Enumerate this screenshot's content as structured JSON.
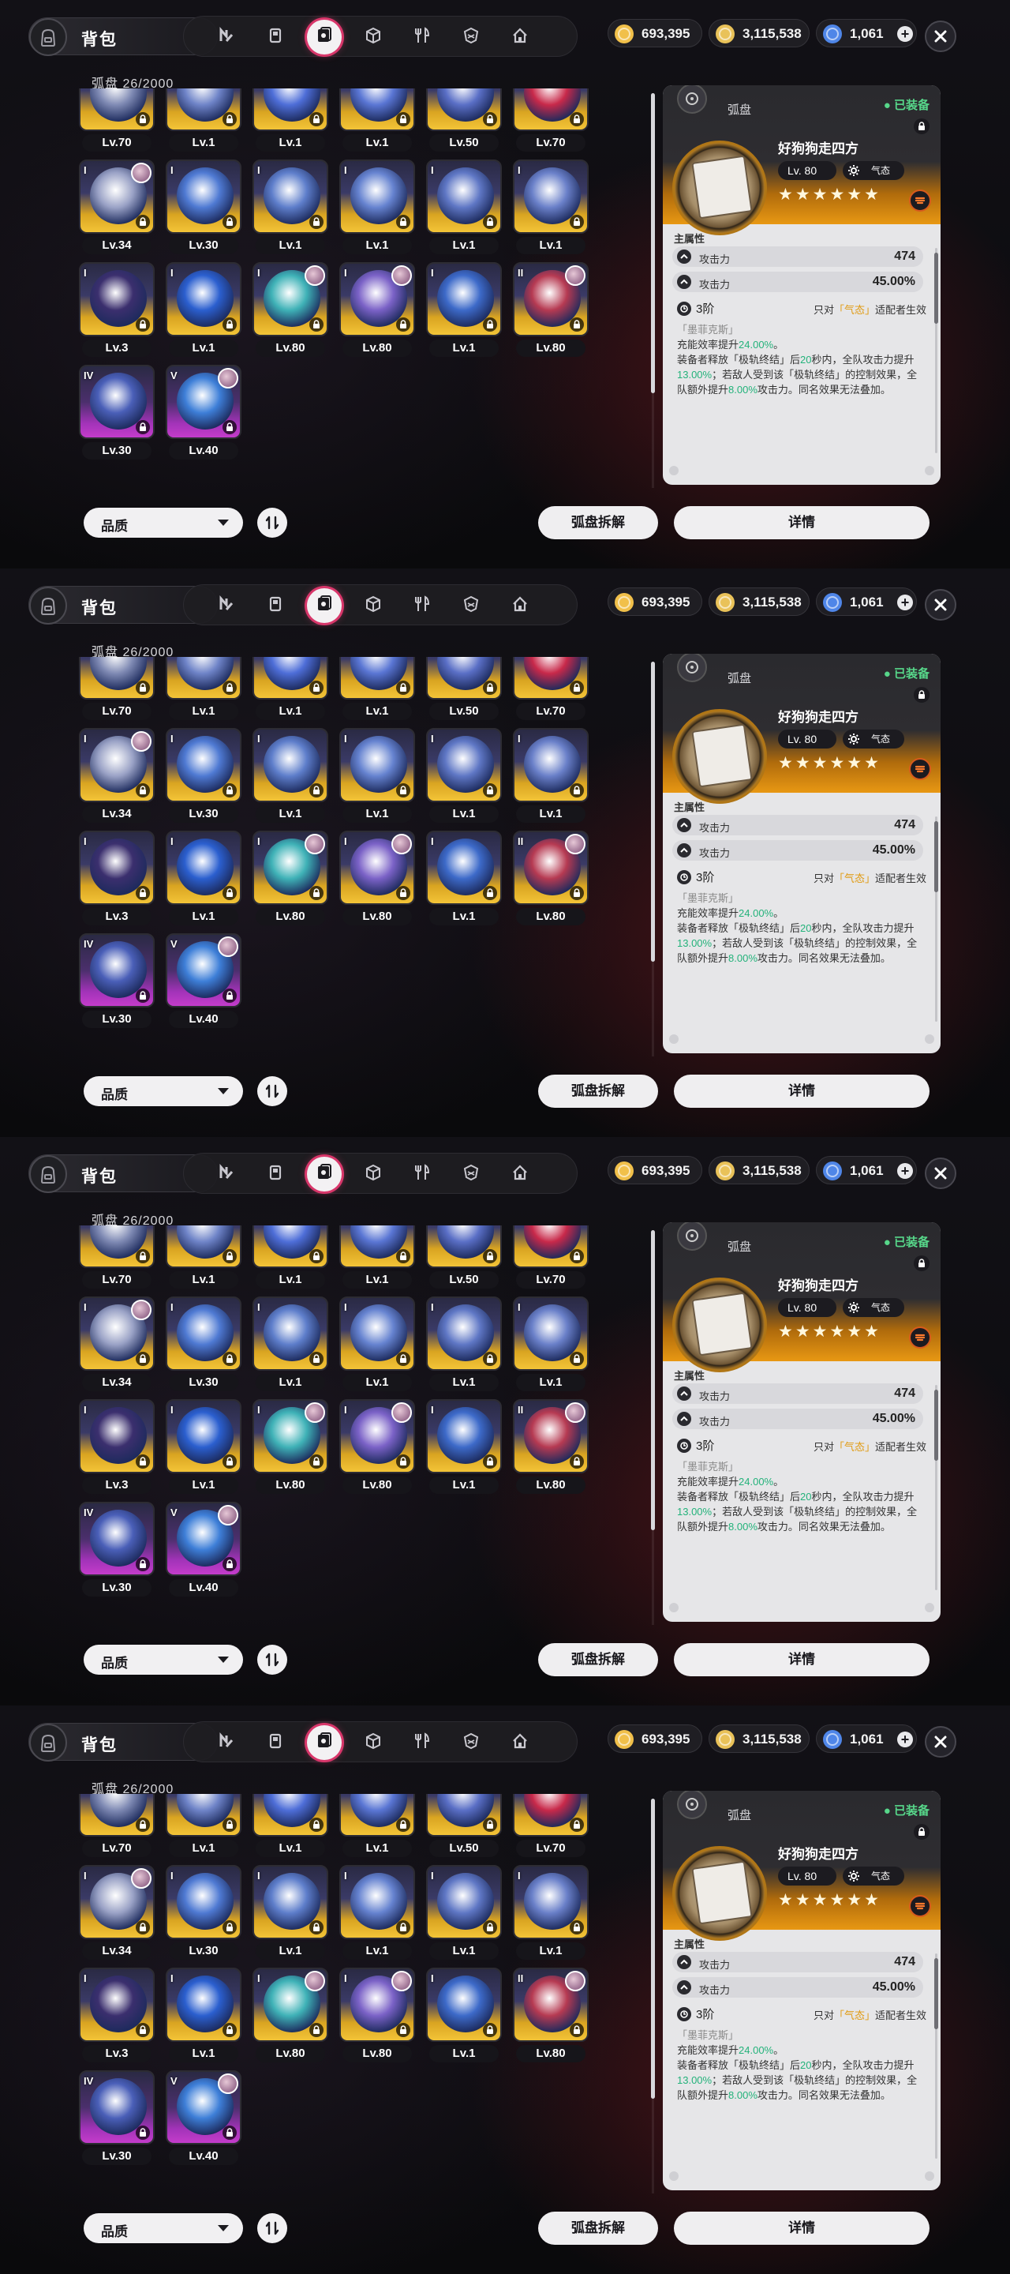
{
  "header": {
    "title": "背包"
  },
  "tabs": [
    {
      "icon": "drive-disc-n-icon"
    },
    {
      "icon": "device-icon"
    },
    {
      "icon": "disc-icon",
      "active": true
    },
    {
      "icon": "cube-icon"
    },
    {
      "icon": "utensils-icon"
    },
    {
      "icon": "badge-icon"
    },
    {
      "icon": "home-icon"
    }
  ],
  "currencies": [
    {
      "icon": "coin-icon",
      "value": "693,395",
      "color": "#f1c04a",
      "plus": false
    },
    {
      "icon": "ticket-icon",
      "value": "3,115,538",
      "color": "#e9c259",
      "plus": false
    },
    {
      "icon": "polychrome-icon",
      "value": "1,061",
      "color": "#4f86e8",
      "plus": true
    }
  ],
  "inventory": {
    "count": "弧盘 26/2000",
    "items": [
      {
        "level": "Lv.70",
        "rarity": "gold",
        "rank": "",
        "char": false,
        "art": "#7f8ab4"
      },
      {
        "level": "Lv.1",
        "rarity": "gold",
        "rank": "",
        "char": false,
        "art": "#6f84c8"
      },
      {
        "level": "Lv.1",
        "rarity": "gold",
        "rank": "",
        "char": false,
        "art": "#4e6ed8"
      },
      {
        "level": "Lv.1",
        "rarity": "gold",
        "rank": "",
        "char": false,
        "art": "#5a76d4"
      },
      {
        "level": "Lv.50",
        "rarity": "gold",
        "rank": "",
        "char": false,
        "art": "#5a6fc6"
      },
      {
        "level": "Lv.70",
        "rarity": "gold",
        "rank": "",
        "char": false,
        "art": "#c8294a"
      },
      {
        "level": "Lv.34",
        "rarity": "gold",
        "rank": "I",
        "char": true,
        "art": "#9aa2c6"
      },
      {
        "level": "Lv.30",
        "rarity": "gold",
        "rank": "I",
        "char": false,
        "art": "#4f7ad3"
      },
      {
        "level": "Lv.1",
        "rarity": "gold",
        "rank": "I",
        "char": false,
        "art": "#5e7ecb"
      },
      {
        "level": "Lv.1",
        "rarity": "gold",
        "rank": "I",
        "char": false,
        "art": "#6683d0"
      },
      {
        "level": "Lv.1",
        "rarity": "gold",
        "rank": "I",
        "char": false,
        "art": "#5f77c5"
      },
      {
        "level": "Lv.1",
        "rarity": "gold",
        "rank": "I",
        "char": false,
        "art": "#6a80c9"
      },
      {
        "level": "Lv.3",
        "rarity": "gold",
        "rank": "I",
        "char": false,
        "art": "#3b2f6e"
      },
      {
        "level": "Lv.1",
        "rarity": "gold",
        "rank": "I",
        "char": false,
        "art": "#2b5fcf"
      },
      {
        "level": "Lv.80",
        "rarity": "gold",
        "rank": "I",
        "char": true,
        "art": "#3fb2b7"
      },
      {
        "level": "Lv.80",
        "rarity": "gold",
        "rank": "I",
        "char": true,
        "art": "#7b62c7"
      },
      {
        "level": "Lv.1",
        "rarity": "gold",
        "rank": "I",
        "char": false,
        "art": "#3d6ac9"
      },
      {
        "level": "Lv.80",
        "rarity": "gold",
        "rank": "II",
        "char": true,
        "art": "#b63a52"
      },
      {
        "level": "Lv.30",
        "rarity": "purple",
        "rank": "IV",
        "char": false,
        "art": "#4a5fb8"
      },
      {
        "level": "Lv.40",
        "rarity": "purple",
        "rank": "V",
        "char": true,
        "art": "#3e7fd8"
      }
    ]
  },
  "controls": {
    "sort_label": "品质",
    "dismantle_label": "弧盘拆解",
    "details_label": "详情"
  },
  "detail": {
    "type": "弧盘",
    "equipped": "● 已装备",
    "name": "好狗狗走四方",
    "level": "Lv. 80",
    "attr_label": "气态",
    "stars": "★★★★★★",
    "main_attr_title": "主属性",
    "stats": [
      {
        "name": "攻击力",
        "value": "474"
      },
      {
        "name": "攻击力",
        "value": "45.00%"
      }
    ],
    "tier": "3阶",
    "tier_note_pre": "只对",
    "tier_note_hl": "「气态」",
    "tier_note_post": "适配者生效",
    "effect_name": "「墨菲克斯」",
    "effect_l1a": "充能效率提升",
    "effect_v1": "24.00%",
    "effect_l1b": "。",
    "effect_l2a": "装备者释放「极轨终结」后",
    "effect_v2": "20",
    "effect_l2b": "秒内，全队攻击力提升",
    "effect_v3": "13.00%",
    "effect_l2c": "；若敌人受到该「极轨终结」的控制效果，全队额外提升",
    "effect_v4": "8.00%",
    "effect_l2d": "攻击力。同名效果无法叠加。"
  }
}
